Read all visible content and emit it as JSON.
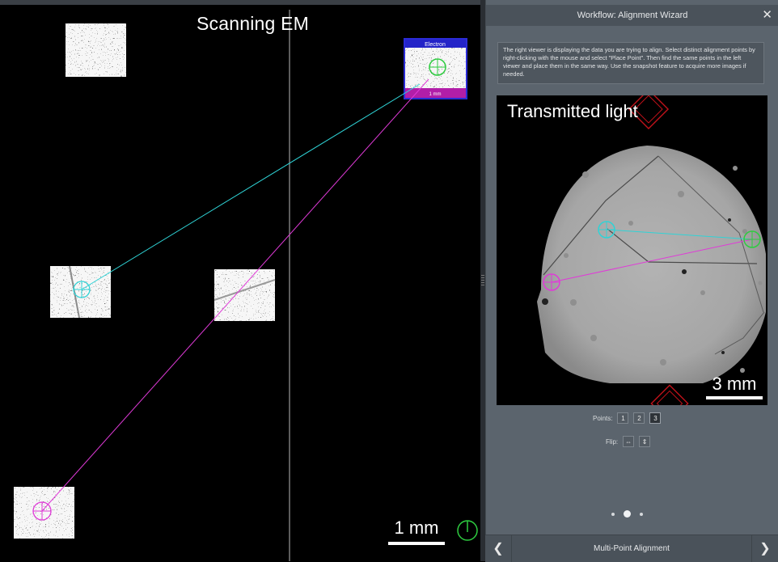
{
  "left_viewer": {
    "title": "Scanning EM",
    "scale_label": "1 mm",
    "thumbnail_top_label": "Electron",
    "thumbnail_bottom_label": "1 mm"
  },
  "panel": {
    "header_title": "Workflow:  Alignment Wizard",
    "close_glyph": "✕",
    "instructions": "The right viewer is displaying the data you are trying to align. Select distinct alignment points by right-clicking with the mouse and select \"Place Point\". Then find the same points in the left viewer and place them in the same way. Use the snapshot feature to acquire more images if needed.",
    "points_label": "Points:",
    "points": [
      "1",
      "2",
      "3"
    ],
    "flip_label": "Flip:",
    "flip_h_glyph": "⇔",
    "flip_v_glyph": "⇕",
    "pager": {
      "count": 3,
      "active": 1
    },
    "footer_label": "Multi-Point Alignment",
    "prev_glyph": "❮",
    "next_glyph": "❯"
  },
  "right_viewer": {
    "title": "Transmitted light",
    "scale_label": "3 mm"
  },
  "colors": {
    "point_cyan": "#2fd3d6",
    "point_magenta": "#e03ad8",
    "point_green": "#2ecc40",
    "diamond_red": "#c1121a",
    "panel_bg": "#5b646d"
  }
}
